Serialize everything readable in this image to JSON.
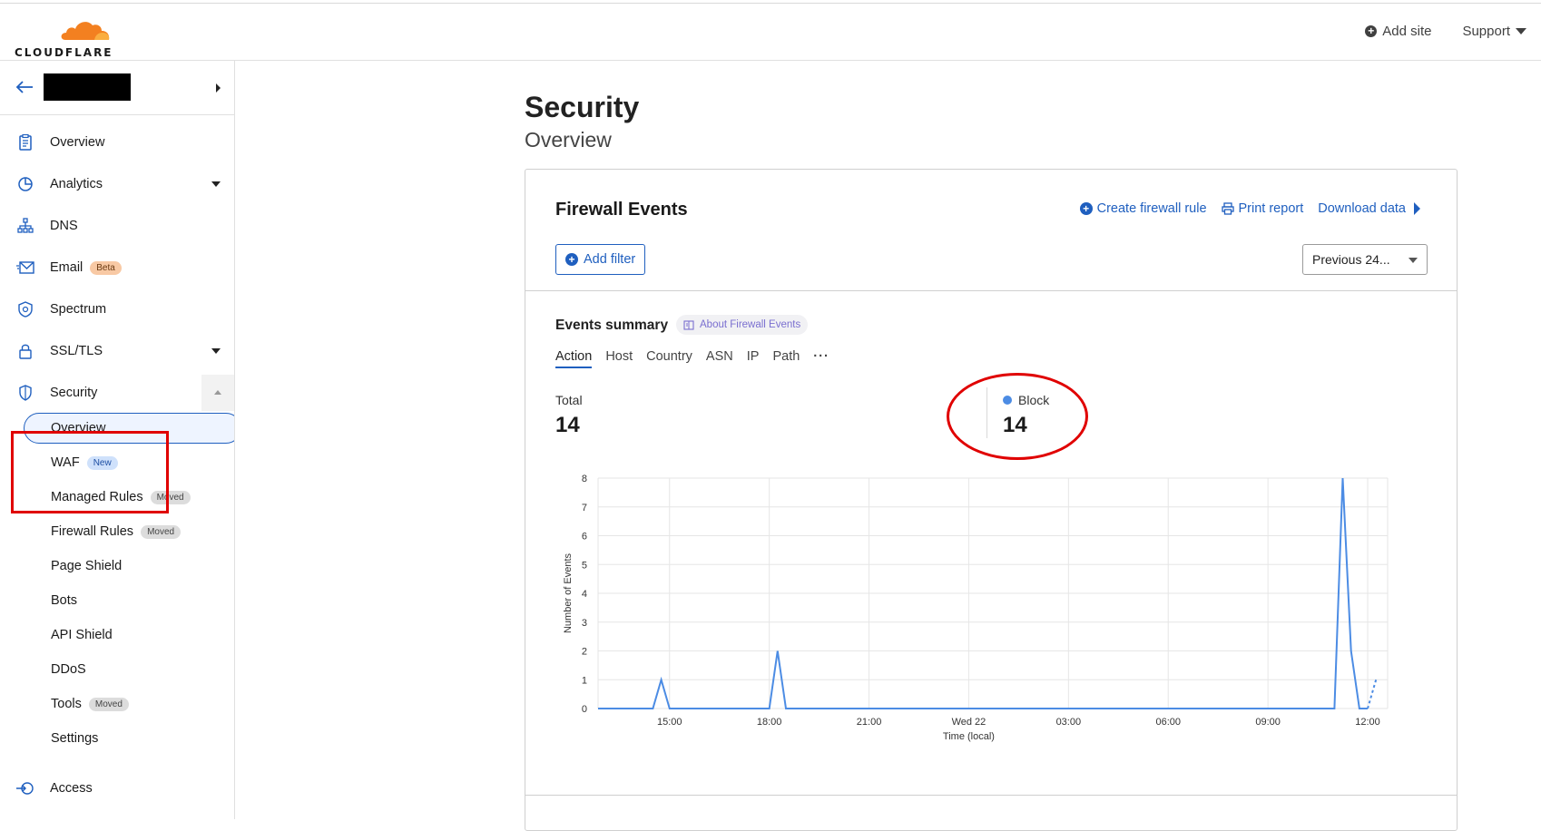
{
  "header": {
    "brand": "CLOUDFLARE",
    "add_site": "Add site",
    "support": "Support",
    "colors": {
      "brand_orange": "#f38020",
      "link_blue": "#1f5fbf"
    }
  },
  "sidebar": {
    "items": [
      {
        "label": "Overview",
        "icon": "clipboard-icon"
      },
      {
        "label": "Analytics",
        "icon": "pie-chart-icon"
      },
      {
        "label": "DNS",
        "icon": "network-icon"
      },
      {
        "label": "Email",
        "icon": "envelope-icon",
        "badge": "Beta"
      },
      {
        "label": "Spectrum",
        "icon": "shield-star-icon"
      },
      {
        "label": "SSL/TLS",
        "icon": "lock-icon"
      },
      {
        "label": "Security",
        "icon": "shield-icon"
      }
    ],
    "security_sub": [
      {
        "label": "Overview"
      },
      {
        "label": "WAF",
        "badge": "New"
      },
      {
        "label": "Managed Rules",
        "badge": "Moved"
      },
      {
        "label": "Firewall Rules",
        "badge": "Moved"
      },
      {
        "label": "Page Shield"
      },
      {
        "label": "Bots"
      },
      {
        "label": "API Shield"
      },
      {
        "label": "DDoS"
      },
      {
        "label": "Tools",
        "badge": "Moved"
      },
      {
        "label": "Settings"
      }
    ],
    "access": {
      "label": "Access",
      "icon": "access-icon"
    }
  },
  "main": {
    "title": "Security",
    "subtitle": "Overview",
    "card": {
      "title": "Firewall Events",
      "actions": {
        "create_rule": "Create firewall rule",
        "print": "Print report",
        "download": "Download data"
      },
      "add_filter": "Add filter",
      "time_range": "Previous 24...",
      "summary_title": "Events summary",
      "about_link": "About Firewall Events",
      "tabs": [
        "Action",
        "Host",
        "Country",
        "ASN",
        "IP",
        "Path",
        "···"
      ],
      "total_label": "Total",
      "total_value": "14",
      "block_label": "Block",
      "block_value": "14"
    }
  },
  "chart_data": {
    "type": "line",
    "ylabel": "Number of Events",
    "xlabel": "Time (local)",
    "ylim": [
      0,
      8
    ],
    "yticks": [
      0,
      1,
      2,
      3,
      4,
      5,
      6,
      7,
      8
    ],
    "xlim": [
      12.85,
      36.6
    ],
    "xticks": [
      {
        "value": 15,
        "label": "15:00"
      },
      {
        "value": 18,
        "label": "18:00"
      },
      {
        "value": 21,
        "label": "21:00"
      },
      {
        "value": 24,
        "label": "Wed 22"
      },
      {
        "value": 27,
        "label": "03:00"
      },
      {
        "value": 30,
        "label": "06:00"
      },
      {
        "value": 33,
        "label": "09:00"
      },
      {
        "value": 36,
        "label": "12:00"
      }
    ],
    "grid": true,
    "series": [
      {
        "name": "Block",
        "color": "#4c8ce4",
        "points": [
          [
            12.85,
            0
          ],
          [
            14.5,
            0
          ],
          [
            14.75,
            1
          ],
          [
            15.0,
            0
          ],
          [
            18.0,
            0
          ],
          [
            18.25,
            2
          ],
          [
            18.5,
            0
          ],
          [
            35.0,
            0
          ],
          [
            35.25,
            8
          ],
          [
            35.5,
            2
          ],
          [
            35.75,
            0
          ],
          [
            36.0,
            0
          ]
        ],
        "partial_points": [
          [
            36.0,
            0
          ],
          [
            36.25,
            1
          ]
        ]
      }
    ]
  }
}
